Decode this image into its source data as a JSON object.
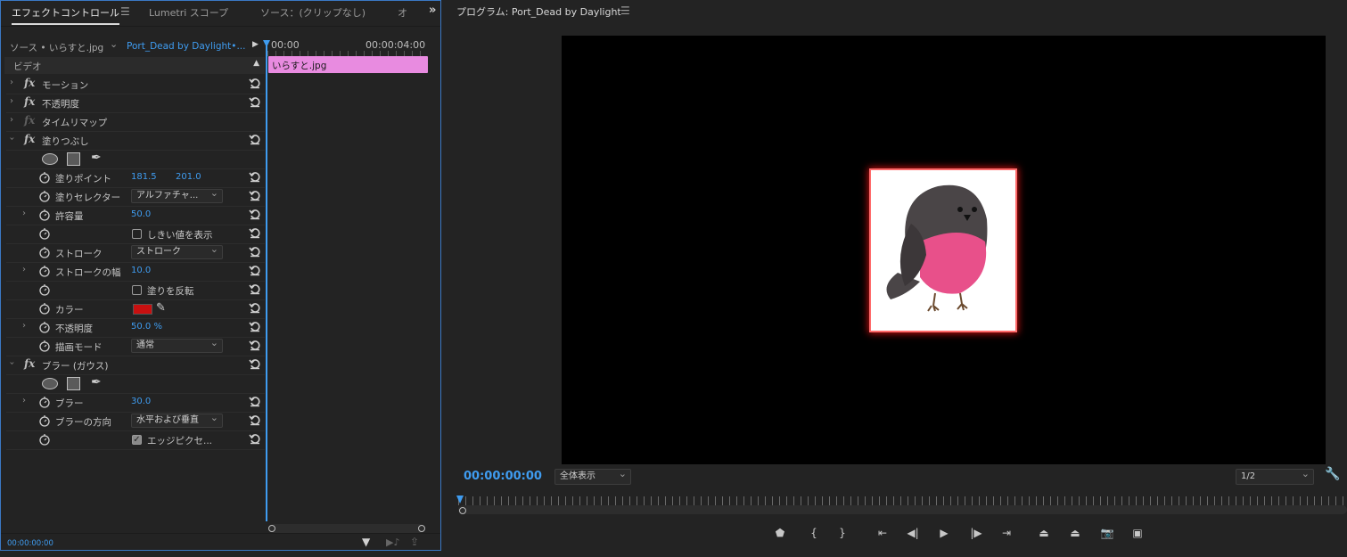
{
  "left_panel": {
    "tabs": [
      "エフェクトコントロール",
      "Lumetri スコープ",
      "ソース：(クリップなし)",
      "オ"
    ],
    "source_label": "ソース • いらすと.jpg",
    "sequence_label": "Port_Dead by Daylight•...",
    "timecode_start": "00:00",
    "timecode_end": "00:00:04:00",
    "clip_name": "いらすと.jpg",
    "section_label": "ビデオ",
    "effects": {
      "motion": "モーション",
      "opacity": "不透明度",
      "time_remap": "タイムリマップ",
      "fill": "塗りつぶし",
      "blur": "ブラー (ガウス)"
    },
    "fill_params": {
      "point_label": "塗りポイント",
      "point_x": "181.5",
      "point_y": "201.0",
      "selector_label": "塗りセレクター",
      "selector_value": "アルファチャ...",
      "tolerance_label": "許容量",
      "tolerance_value": "50.0",
      "threshold_label": "しきい値を表示",
      "stroke_label": "ストローク",
      "stroke_value": "ストローク",
      "stroke_width_label": "ストロークの幅",
      "stroke_width_value": "10.0",
      "invert_label": "塗りを反転",
      "color_label": "カラー",
      "color_value": "#c81010",
      "opacity_label": "不透明度",
      "opacity_value": "50.0 %",
      "blend_label": "描画モード",
      "blend_value": "通常"
    },
    "blur_params": {
      "amount_label": "ブラー",
      "amount_value": "30.0",
      "direction_label": "ブラーの方向",
      "direction_value": "水平および垂直",
      "edge_label": "エッジピクセ..."
    },
    "bottom_timecode": "00:00:00:00"
  },
  "program": {
    "title": "プログラム: Port_Dead by Daylight",
    "timecode": "00:00:00:00",
    "fit_label": "全体表示",
    "resolution": "1/2"
  },
  "colors": {
    "accent": "#3f9cf0",
    "clip_bar": "#e88be0",
    "panel_border": "#3a78c4",
    "bird_body": "#4a4547",
    "bird_belly": "#e8508a"
  }
}
